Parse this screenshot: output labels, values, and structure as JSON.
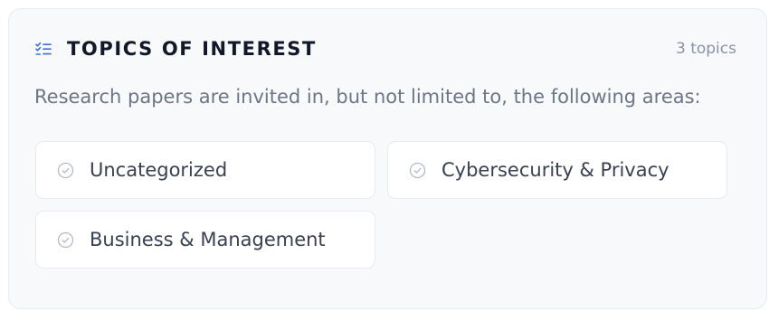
{
  "section": {
    "title": "TOPICS OF INTEREST",
    "count_label": "3 topics",
    "description": "Research papers are invited in, but not limited to, the following areas:",
    "icon": "checklist-icon",
    "accent_color": "#3b6fd8"
  },
  "topics": [
    {
      "label": "Uncategorized",
      "icon": "check-circle-icon"
    },
    {
      "label": "Cybersecurity & Privacy",
      "icon": "check-circle-icon"
    },
    {
      "label": "Business & Management",
      "icon": "check-circle-icon"
    }
  ]
}
